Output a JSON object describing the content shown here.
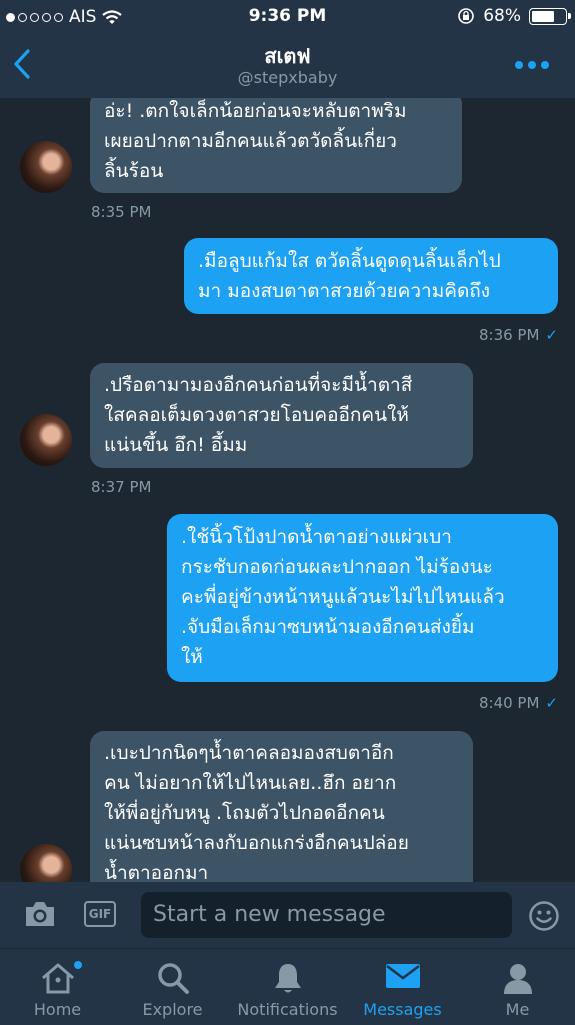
{
  "status_bar": {
    "carrier": "AIS",
    "time": "9:36 PM",
    "battery": "68%",
    "battery_level": 0.68,
    "signal_bars_filled": 1
  },
  "header": {
    "title": "สเตฟ",
    "handle": "@stepxbaby"
  },
  "messages": [
    {
      "direction": "in",
      "text": "อ่ะ! .ตกใจเล็กน้อยก่อนจะหลับตาพริม\nเผยอปากตามอีกคนแล้วตวัดลิ้นเกี่ยว\nลิ้นร้อน",
      "time": "8:35 PM"
    },
    {
      "direction": "out",
      "text": ".มือลูบแก้มใส ตวัดลิ้นดูดดุนลิ้นเล็กไป\nมา มองสบตาตาสวยด้วยความคิดถึง",
      "time": "8:36 PM"
    },
    {
      "direction": "in",
      "text": ".ปรือตามามองอีกคนก่อนที่จะมีน้ำตาสี\nใสคลอเต็มดวงตาสวยโอบคออีกคนให้\nแน่นขึ้น อึก! อึ้มม",
      "time": "8:37 PM"
    },
    {
      "direction": "out",
      "text": ".ใช้นิ้วโป้งปาดน้ำตาอย่างแผ่วเบา\nกระชับกอดก่อนผละปากออก ไม่ร้องนะ\nคะพี่อยู่ข้างหน้าหนูแล้วนะไม่ไปไหนแล้ว\n.จับมือเล็กมาซบหน้ามองอีกคนส่งยิ้ม\nให้",
      "time": "8:40 PM"
    },
    {
      "direction": "in",
      "text": ".เบะปากนิดๆน้ำตาคลอมองสบตาอีก\nคน ไม่อยากให้ไปไหนเลย..ฮึก อยาก\nให้พี่อยู่กับหนู .โถมตัวไปกอดอีกคน\nแน่นซบหน้าลงกับอกแกร่งอีกคนปล่อย\nน้ำตาออกมา",
      "time": ""
    }
  ],
  "composer": {
    "gif_label": "GIF",
    "placeholder": "Start a new message"
  },
  "tabs": [
    {
      "label": "Home",
      "icon": "home-icon",
      "has_dot": true
    },
    {
      "label": "Explore",
      "icon": "search-icon"
    },
    {
      "label": "Notifications",
      "icon": "bell-icon"
    },
    {
      "label": "Messages",
      "icon": "envelope-icon",
      "active": true
    },
    {
      "label": "Me",
      "icon": "person-icon"
    }
  ],
  "colors": {
    "accent": "#1da1f2",
    "background": "#1c2732",
    "bar": "#243447",
    "incoming_bubble": "#3d5466",
    "muted": "#8899a6"
  }
}
